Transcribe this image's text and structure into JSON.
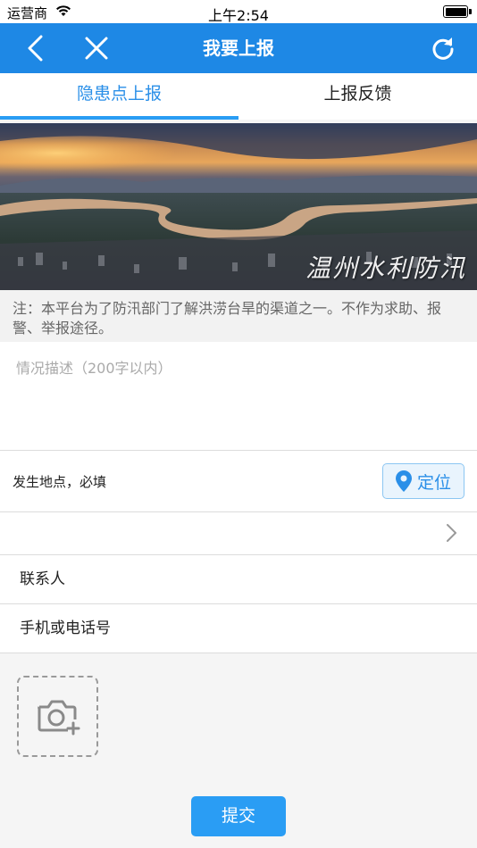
{
  "status_bar": {
    "carrier": "运营商",
    "time": "上午2:54"
  },
  "nav": {
    "title": "我要上报",
    "back_icon": "chevron-left-icon",
    "close_icon": "close-icon",
    "refresh_icon": "refresh-icon",
    "background_color": "#1e88e5"
  },
  "tabs": [
    {
      "label": "隐患点上报",
      "active": true
    },
    {
      "label": "上报反馈",
      "active": false
    }
  ],
  "banner": {
    "caption": "温州水利防汛"
  },
  "notice": "注：本平台为了防汛部门了解洪涝台旱的渠道之一。不作为求助、报警、举报途径。",
  "description": {
    "placeholder": "情况描述（200字以内）",
    "value": ""
  },
  "location": {
    "label": "发生地点，必填",
    "locate_button": "定位",
    "locate_icon": "map-pin-icon"
  },
  "address": {
    "value": "",
    "chevron_icon": "chevron-right-icon"
  },
  "contact": {
    "placeholder": "联系人"
  },
  "phone": {
    "placeholder": "手机或电话号"
  },
  "photo": {
    "icon": "camera-add-icon"
  },
  "submit": {
    "label": "提交",
    "color": "#2a9df4"
  }
}
